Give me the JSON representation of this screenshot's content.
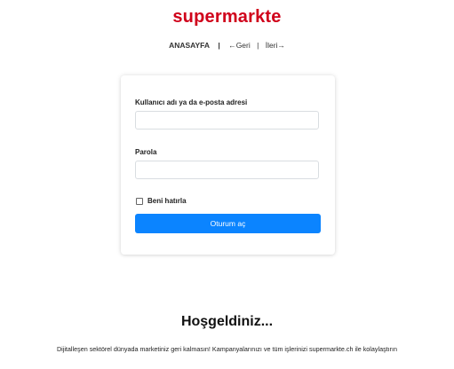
{
  "header": {
    "logo": "supermarkte"
  },
  "nav": {
    "home": "ANASAYFA",
    "separator": "|",
    "back": "←Geri",
    "forward_separator": "|",
    "forward": "İleri→"
  },
  "login": {
    "username_label": "Kullanıcı adı ya da e-posta adresi",
    "username_value": "",
    "password_label": "Parola",
    "password_value": "",
    "remember_label": "Beni hatırla",
    "remember_checked": false,
    "submit_label": "Oturum aç"
  },
  "welcome": {
    "title": "Hoşgeldiniz...",
    "text": "Dijitalleşen sektörel dünyada marketiniz geri kalmasın! Kampanyalarınızı ve tüm işlerinizi supermarkte.ch ile kolaylaştırın"
  },
  "colors": {
    "brand": "#d0021b",
    "primary_button": "#0b84ff"
  }
}
